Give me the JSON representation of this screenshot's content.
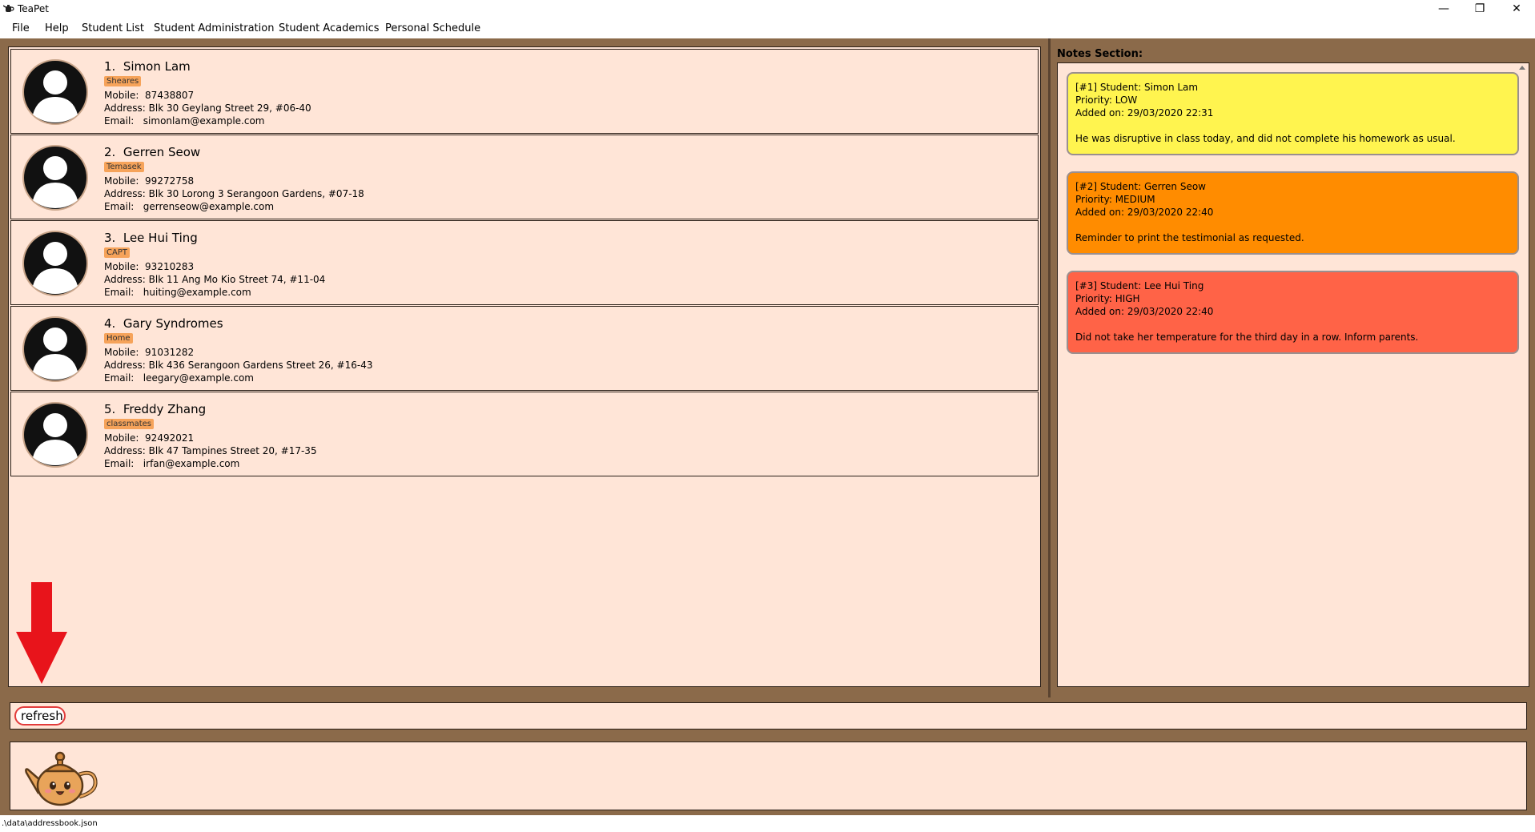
{
  "window": {
    "title": "TeaPet",
    "minimize_icon": "minimize-icon",
    "maximize_icon": "restore-icon",
    "close_icon": "close-icon"
  },
  "menu": [
    "File",
    "Help",
    "Student List",
    "Student Administration",
    "Student Academics",
    "Personal Schedule"
  ],
  "labels": {
    "mobile": "Mobile:",
    "address": "Address:",
    "email": "Email:"
  },
  "students": [
    {
      "index": "1.",
      "name": "Simon Lam",
      "tag": "Sheares",
      "mobile": "87438807",
      "address": "Blk 30 Geylang Street 29, #06-40",
      "email": "simonlam@example.com"
    },
    {
      "index": "2.",
      "name": "Gerren Seow",
      "tag": "Temasek",
      "mobile": "99272758",
      "address": "Blk 30 Lorong 3 Serangoon Gardens, #07-18",
      "email": "gerrenseow@example.com"
    },
    {
      "index": "3.",
      "name": "Lee Hui Ting",
      "tag": "CAPT",
      "mobile": "93210283",
      "address": "Blk 11 Ang Mo Kio Street 74, #11-04",
      "email": "huiting@example.com"
    },
    {
      "index": "4.",
      "name": "Gary Syndromes",
      "tag": "Home",
      "mobile": "91031282",
      "address": "Blk 436 Serangoon Gardens Street 26, #16-43",
      "email": "leegary@example.com"
    },
    {
      "index": "5.",
      "name": "Freddy Zhang",
      "tag": "classmates",
      "mobile": "92492021",
      "address": "Blk 47 Tampines Street 20, #17-35",
      "email": "irfan@example.com"
    }
  ],
  "notes": {
    "title": "Notes Section:",
    "items": [
      {
        "header": "[#1] Student: Simon Lam",
        "priority": "Priority: LOW",
        "added": "Added on: 29/03/2020 22:31",
        "text": "He was disruptive in class today, and did not complete his homework as usual.",
        "color": "#fff44f"
      },
      {
        "header": "[#2] Student: Gerren Seow",
        "priority": "Priority: MEDIUM",
        "added": "Added on: 29/03/2020 22:40",
        "text": "Reminder to print the testimonial as requested.",
        "color": "#ff8c00"
      },
      {
        "header": "[#3] Student: Lee Hui Ting",
        "priority": "Priority: HIGH",
        "added": "Added on: 29/03/2020 22:40",
        "text": "Did not take her temperature for the third day in a row. Inform parents.",
        "color": "#ff6347"
      }
    ]
  },
  "command": {
    "value": "refresh"
  },
  "status": {
    "path": ".\\data\\addressbook.json"
  },
  "colors": {
    "background": "#8b6a4a",
    "panel": "#ffe5d7",
    "tag": "#f6a35a",
    "arrow": "#e8141b",
    "command_border": "#e23b3b"
  }
}
